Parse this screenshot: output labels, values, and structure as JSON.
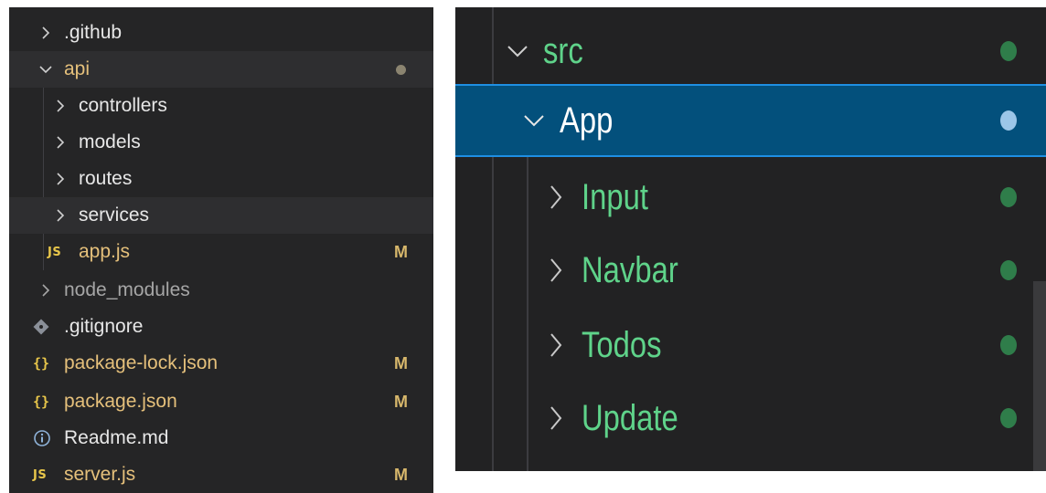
{
  "left_explorer": {
    "items": [
      {
        "label": ".github",
        "icon": "chevron-right-icon",
        "status": ""
      },
      {
        "label": "api",
        "icon": "chevron-down-icon",
        "status": "dot"
      },
      {
        "label": "controllers",
        "icon": "chevron-right-icon",
        "status": ""
      },
      {
        "label": "models",
        "icon": "chevron-right-icon",
        "status": ""
      },
      {
        "label": "routes",
        "icon": "chevron-right-icon",
        "status": ""
      },
      {
        "label": "services",
        "icon": "chevron-right-icon",
        "status": ""
      },
      {
        "label": "app.js",
        "icon": "js-file-icon",
        "icon_text": "JS",
        "status": "M"
      },
      {
        "label": "node_modules",
        "icon": "chevron-right-icon",
        "status": ""
      },
      {
        "label": ".gitignore",
        "icon": "git-icon",
        "status": ""
      },
      {
        "label": "package-lock.json",
        "icon": "json-file-icon",
        "icon_text": "{}",
        "status": "M"
      },
      {
        "label": "package.json",
        "icon": "json-file-icon",
        "icon_text": "{}",
        "status": "M"
      },
      {
        "label": "Readme.md",
        "icon": "info-icon",
        "status": ""
      },
      {
        "label": "server.js",
        "icon": "js-file-icon",
        "icon_text": "JS",
        "status": "M"
      }
    ]
  },
  "right_explorer": {
    "items": [
      {
        "label": "src",
        "icon": "chevron-down-icon",
        "status": "dot"
      },
      {
        "label": "App",
        "icon": "chevron-down-icon",
        "status": "dot",
        "selected": true
      },
      {
        "label": "Input",
        "icon": "chevron-right-icon",
        "status": "dot"
      },
      {
        "label": "Navbar",
        "icon": "chevron-right-icon",
        "status": "dot"
      },
      {
        "label": "Todos",
        "icon": "chevron-right-icon",
        "status": "dot"
      },
      {
        "label": "Update",
        "icon": "chevron-right-icon",
        "status": "dot"
      }
    ]
  },
  "colors": {
    "background": "#252526",
    "modified": "#e5c07b",
    "folder_green": "#5fd38a",
    "selection": "#03507c",
    "selection_border": "#1e8fe3"
  }
}
